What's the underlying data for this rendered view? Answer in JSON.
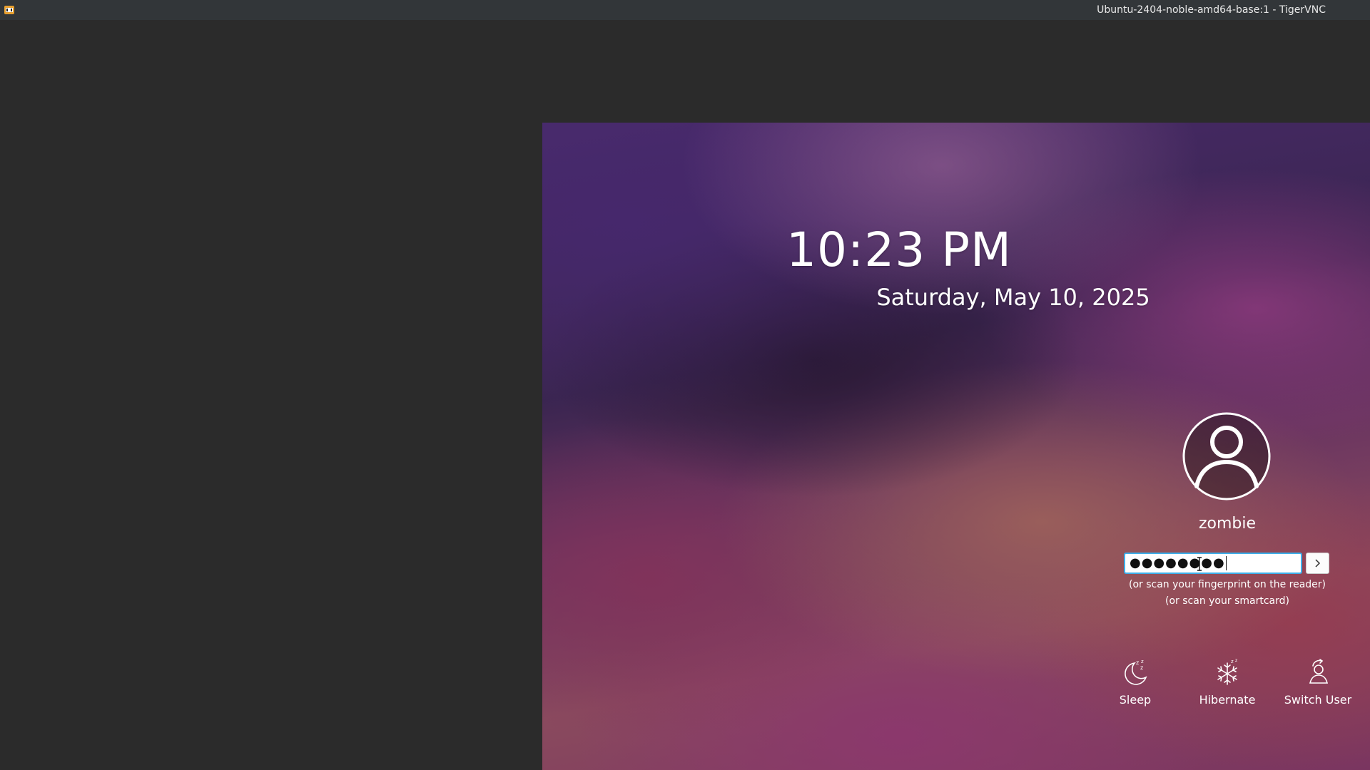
{
  "window": {
    "title": "Ubuntu-2404-noble-amd64-base:1 - TigerVNC",
    "app_icon": "tigervnc-icon"
  },
  "lockscreen": {
    "time": "10:23 PM",
    "date": "Saturday, May 10, 2025",
    "avatar_icon": "user-avatar-icon",
    "username": "zombie",
    "password_masked": "●●●●●●●●",
    "submit_icon": "chevron-right-icon",
    "hint_fingerprint": "(or scan your fingerprint on the reader)",
    "hint_smartcard": "(or scan your smartcard)",
    "actions": [
      {
        "label": "Sleep",
        "icon": "sleep-moon-icon"
      },
      {
        "label": "Hibernate",
        "icon": "snowflake-icon"
      },
      {
        "label": "Switch User",
        "icon": "switch-user-icon"
      }
    ]
  },
  "colors": {
    "titlebar_bg": "#323639",
    "backdrop": "#2b2b2b",
    "focus_border": "#3daee9",
    "text": "#ffffff"
  }
}
